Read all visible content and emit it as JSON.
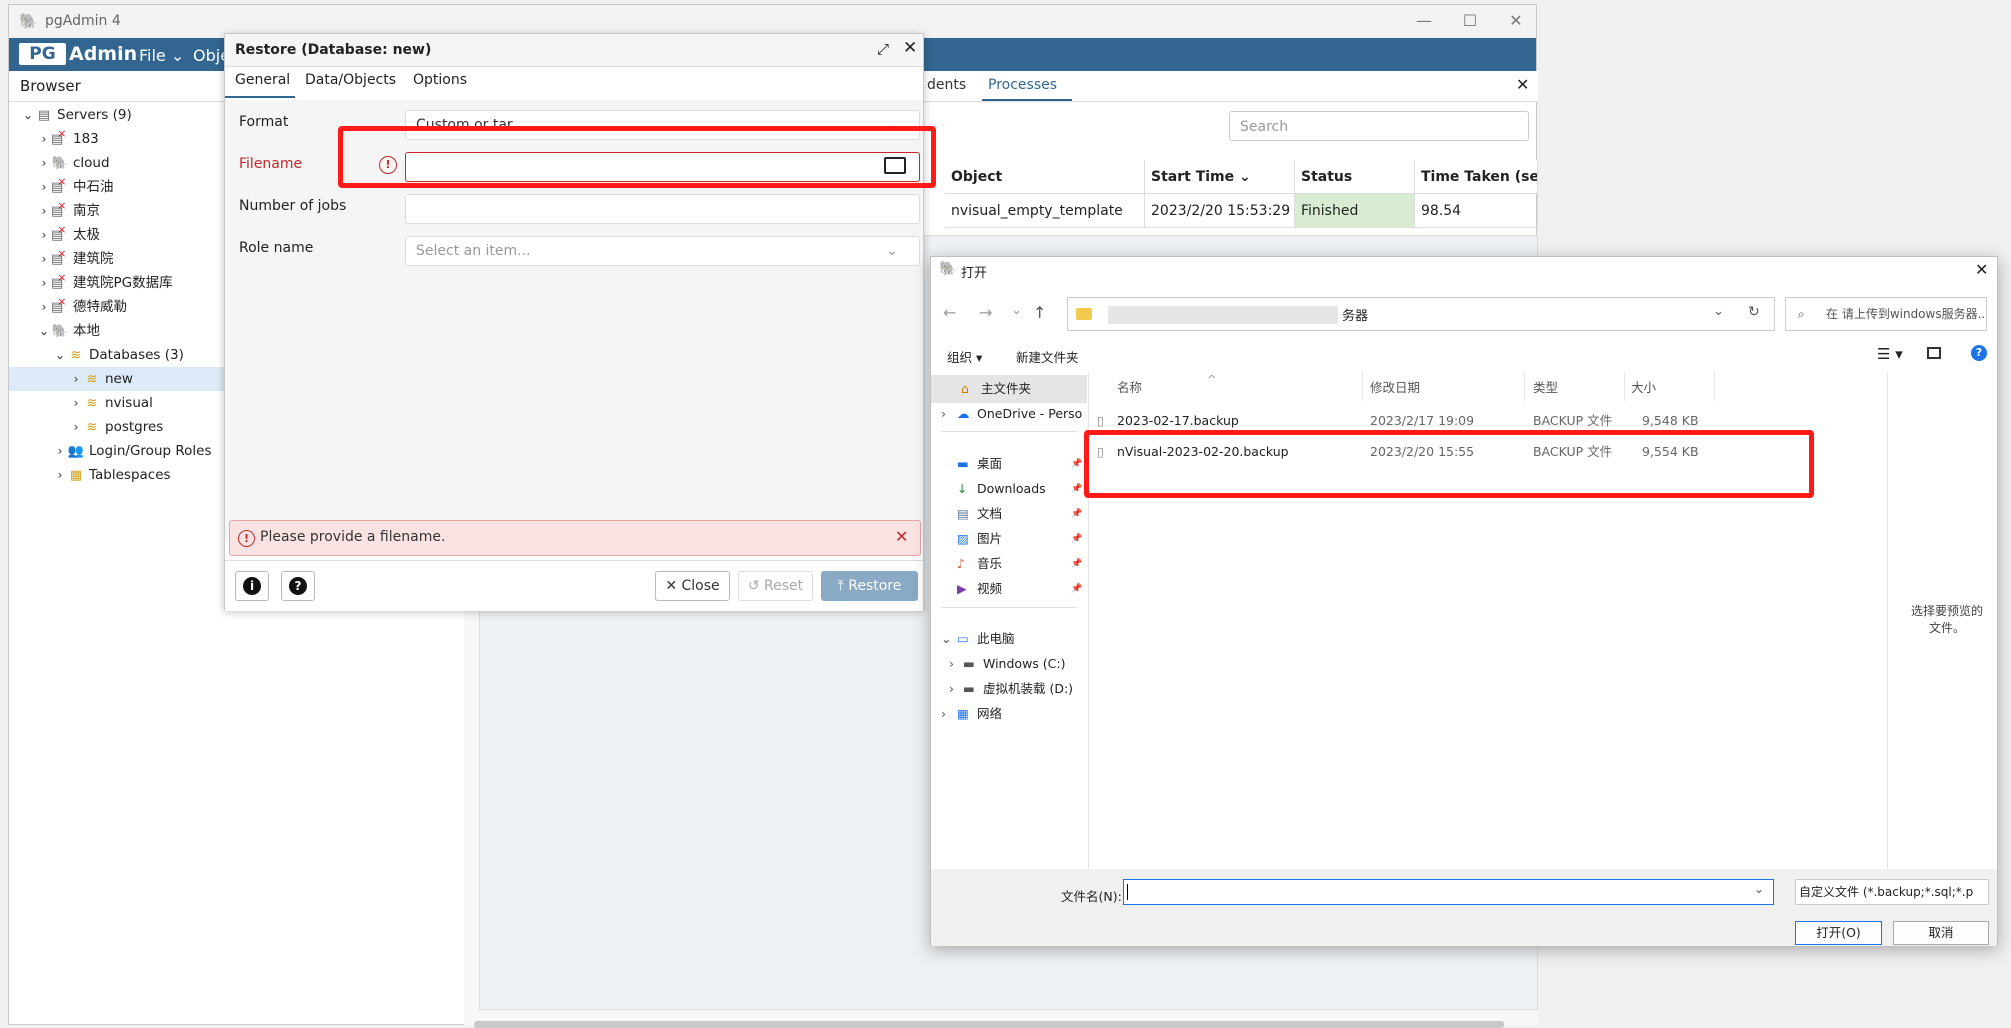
{
  "app": {
    "title": "pgAdmin 4",
    "logo_pg": "PG",
    "logo_admin": "Admin",
    "menu": [
      "File",
      "Obje"
    ],
    "browser_label": "Browser"
  },
  "tree": [
    {
      "label": "Servers (9)",
      "level": 0,
      "expanded": true,
      "icon": "servers-icon"
    },
    {
      "label": "183",
      "level": 1,
      "expanded": false,
      "icon": "server-disconnected-icon"
    },
    {
      "label": "cloud",
      "level": 1,
      "expanded": false,
      "icon": "elephant-icon"
    },
    {
      "label": "中石油",
      "level": 1,
      "expanded": false,
      "icon": "server-disconnected-icon"
    },
    {
      "label": "南京",
      "level": 1,
      "expanded": false,
      "icon": "server-disconnected-icon"
    },
    {
      "label": "太极",
      "level": 1,
      "expanded": false,
      "icon": "server-disconnected-icon"
    },
    {
      "label": "建筑院",
      "level": 1,
      "expanded": false,
      "icon": "server-disconnected-icon"
    },
    {
      "label": "建筑院PG数据库",
      "level": 1,
      "expanded": false,
      "icon": "server-disconnected-icon"
    },
    {
      "label": "德特威勒",
      "level": 1,
      "expanded": false,
      "icon": "server-disconnected-icon"
    },
    {
      "label": "本地",
      "level": 1,
      "expanded": true,
      "icon": "elephant-icon"
    },
    {
      "label": "Databases (3)",
      "level": 2,
      "expanded": true,
      "icon": "databases-icon"
    },
    {
      "label": "new",
      "level": 3,
      "expanded": false,
      "icon": "database-icon",
      "selected": true
    },
    {
      "label": "nvisual",
      "level": 3,
      "expanded": false,
      "icon": "database-icon"
    },
    {
      "label": "postgres",
      "level": 3,
      "expanded": false,
      "icon": "database-icon"
    },
    {
      "label": "Login/Group Roles",
      "level": 2,
      "expanded": false,
      "icon": "roles-icon"
    },
    {
      "label": "Tablespaces",
      "level": 2,
      "expanded": false,
      "icon": "tablespaces-icon"
    }
  ],
  "processes": {
    "tab_partial": "dents",
    "tab_active": "Processes",
    "search_placeholder": "Search",
    "columns": [
      "Object",
      "Start Time ⌄",
      "Status",
      "Time Taken (sec)"
    ],
    "rows": [
      {
        "object": "nvisual_empty_template",
        "start_time": "2023/2/20 15:53:29",
        "status": "Finished",
        "time_taken": "98.54"
      }
    ]
  },
  "restore_dialog": {
    "title": "Restore (Database: new)",
    "tabs": [
      "General",
      "Data/Objects",
      "Options"
    ],
    "fields": {
      "format_label": "Format",
      "format_value": "Custom or tar",
      "filename_label": "Filename",
      "filename_value": "",
      "jobs_label": "Number of jobs",
      "role_label": "Role name",
      "role_placeholder": "Select an item..."
    },
    "error_message": "Please provide a filename.",
    "buttons": {
      "close": "Close",
      "reset": "Reset",
      "restore": "Restore"
    }
  },
  "open_dialog": {
    "title": "打开",
    "address_suffix": "务器",
    "search_placeholder": "在 请上传到windows服务器...",
    "toolbar": {
      "organize": "组织 ▾",
      "new_folder": "新建文件夹"
    },
    "nav": [
      {
        "label": "主文件夹",
        "icon": "home-icon"
      },
      {
        "label": "OneDrive - Perso",
        "icon": "onedrive-icon"
      },
      {
        "label": "桌面",
        "icon": "desktop-icon"
      },
      {
        "label": "Downloads",
        "icon": "download-icon"
      },
      {
        "label": "文档",
        "icon": "document-icon"
      },
      {
        "label": "图片",
        "icon": "picture-icon"
      },
      {
        "label": "音乐",
        "icon": "music-icon"
      },
      {
        "label": "视频",
        "icon": "video-icon"
      },
      {
        "label": "此电脑",
        "icon": "computer-icon"
      },
      {
        "label": "Windows (C:)",
        "icon": "drive-icon"
      },
      {
        "label": "虚拟机装载 (D:)",
        "icon": "drive-icon"
      },
      {
        "label": "网络",
        "icon": "network-icon"
      }
    ],
    "columns": [
      "名称",
      "修改日期",
      "类型",
      "大小"
    ],
    "files": [
      {
        "name": "2023-02-17.backup",
        "date": "2023/2/17 19:09",
        "type": "BACKUP 文件",
        "size": "9,548 KB"
      },
      {
        "name": "nVisual-2023-02-20.backup",
        "date": "2023/2/20 15:55",
        "type": "BACKUP 文件",
        "size": "9,554 KB"
      }
    ],
    "preview_text": "选择要预览的文件。",
    "filename_label": "文件名(N):",
    "filter_value": "自定义文件 (*.backup;*.sql;*.p",
    "open_button": "打开(O)",
    "cancel_button": "取消"
  },
  "colors": {
    "brand": "#326690",
    "finished": "#d8ecd2",
    "error": "#c62828",
    "annotation": "#ff1a1a"
  }
}
